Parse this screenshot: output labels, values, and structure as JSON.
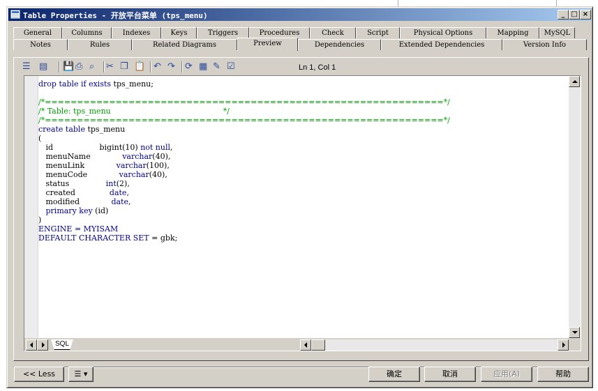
{
  "window": {
    "title": "Table Properties - 开放平台菜单 (tps_menu)"
  },
  "tabs_row1": [
    {
      "label": "General"
    },
    {
      "label": "Columns"
    },
    {
      "label": "Indexes"
    },
    {
      "label": "Keys"
    },
    {
      "label": "Triggers"
    },
    {
      "label": "Procedures"
    },
    {
      "label": "Check"
    },
    {
      "label": "Script"
    },
    {
      "label": "Physical Options"
    },
    {
      "label": "Mapping"
    },
    {
      "label": "MySQL"
    }
  ],
  "tabs_row2": [
    {
      "label": "Notes"
    },
    {
      "label": "Rules"
    },
    {
      "label": "Related Diagrams"
    },
    {
      "label": "Preview"
    },
    {
      "label": "Dependencies"
    },
    {
      "label": "Extended Dependencies"
    },
    {
      "label": "Version Info"
    }
  ],
  "active_tab": "Preview",
  "toolbar": {
    "cursor_position": "Ln 1, Col 1",
    "icons": [
      "layout-icon",
      "new-icon",
      "save-icon",
      "print-icon",
      "find-icon",
      "cut-icon",
      "copy-icon",
      "paste-icon",
      "undo-icon",
      "redo-icon",
      "refresh-icon",
      "sql-icon",
      "edit-icon",
      "check-icon"
    ]
  },
  "editor": {
    "lines": [
      {
        "parts": [
          {
            "t": "drop table if exists",
            "c": "kw"
          },
          {
            "t": " tps_menu;",
            "c": ""
          }
        ]
      },
      {
        "parts": []
      },
      {
        "parts": [
          {
            "t": "/*==============================================================*/",
            "c": "cm"
          }
        ]
      },
      {
        "parts": [
          {
            "t": "/* Table: tps_menu                                              */",
            "c": "cm"
          }
        ]
      },
      {
        "parts": [
          {
            "t": "/*==============================================================*/",
            "c": "cm"
          }
        ]
      },
      {
        "parts": [
          {
            "t": "create table",
            "c": "kw"
          },
          {
            "t": " tps_menu",
            "c": ""
          }
        ]
      },
      {
        "parts": [
          {
            "t": "(",
            "c": ""
          }
        ]
      },
      {
        "parts": [
          {
            "t": "   id                   bigint(10) ",
            "c": ""
          },
          {
            "t": "not null",
            "c": "kw"
          },
          {
            "t": ",",
            "c": ""
          }
        ]
      },
      {
        "parts": [
          {
            "t": "   menuName             ",
            "c": ""
          },
          {
            "t": "varchar",
            "c": "kw"
          },
          {
            "t": "(40),",
            "c": ""
          }
        ]
      },
      {
        "parts": [
          {
            "t": "   menuLink             ",
            "c": ""
          },
          {
            "t": "varchar",
            "c": "kw"
          },
          {
            "t": "(100),",
            "c": ""
          }
        ]
      },
      {
        "parts": [
          {
            "t": "   menuCode             ",
            "c": ""
          },
          {
            "t": "varchar",
            "c": "kw"
          },
          {
            "t": "(40),",
            "c": ""
          }
        ]
      },
      {
        "parts": [
          {
            "t": "   status               ",
            "c": ""
          },
          {
            "t": "int",
            "c": "kw"
          },
          {
            "t": "(2),",
            "c": ""
          }
        ]
      },
      {
        "parts": [
          {
            "t": "   created              ",
            "c": ""
          },
          {
            "t": "date",
            "c": "kw"
          },
          {
            "t": ",",
            "c": ""
          }
        ]
      },
      {
        "parts": [
          {
            "t": "   modified             ",
            "c": ""
          },
          {
            "t": "date",
            "c": "kw"
          },
          {
            "t": ",",
            "c": ""
          }
        ]
      },
      {
        "parts": [
          {
            "t": "   ",
            "c": ""
          },
          {
            "t": "primary key",
            "c": "kw"
          },
          {
            "t": " (id)",
            "c": ""
          }
        ]
      },
      {
        "parts": [
          {
            "t": ")",
            "c": ""
          }
        ]
      },
      {
        "parts": [
          {
            "t": "ENGINE = MYISAM",
            "c": "kw"
          }
        ]
      },
      {
        "parts": [
          {
            "t": "DEFAULT CHARACTER SET",
            "c": "kw"
          },
          {
            "t": " = gbk;",
            "c": ""
          }
        ]
      }
    ],
    "sheet_tab": "SQL"
  },
  "buttons": {
    "less": "<< Less",
    "ok": "确定",
    "cancel": "取消",
    "apply": "应用(A)",
    "help": "帮助"
  },
  "colors": {
    "keyword": "#00008b",
    "comment": "#00a000",
    "title_start": "#0a246a",
    "title_end": "#a6caf0"
  }
}
